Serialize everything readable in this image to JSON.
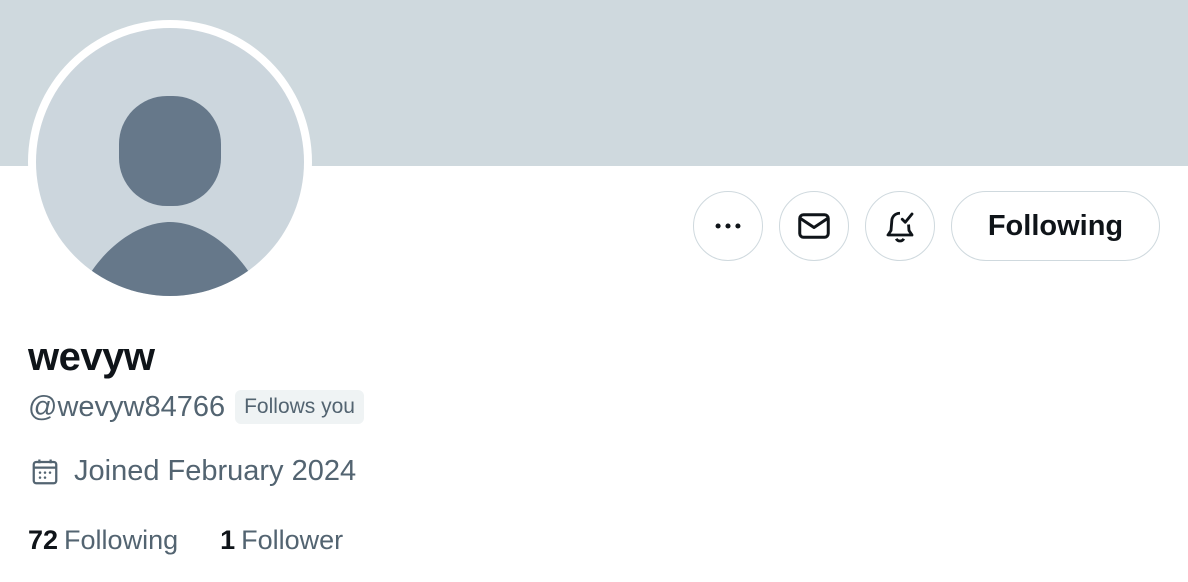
{
  "profile": {
    "display_name": "wevyw",
    "handle": "@wevyw84766",
    "follows_you_badge": "Follows you",
    "joined": "Joined February 2024"
  },
  "actions": {
    "more_icon": "more-horizontal-icon",
    "message_icon": "envelope-icon",
    "notify_icon": "bell-check-icon",
    "following_label": "Following"
  },
  "stats": {
    "following_count": "72",
    "following_label": "Following",
    "followers_count": "1",
    "followers_label": "Follower"
  },
  "colors": {
    "banner": "#cfd9de",
    "avatar_bg": "#ccd6dd",
    "avatar_fg": "#66788a",
    "secondary_text": "#536471"
  }
}
